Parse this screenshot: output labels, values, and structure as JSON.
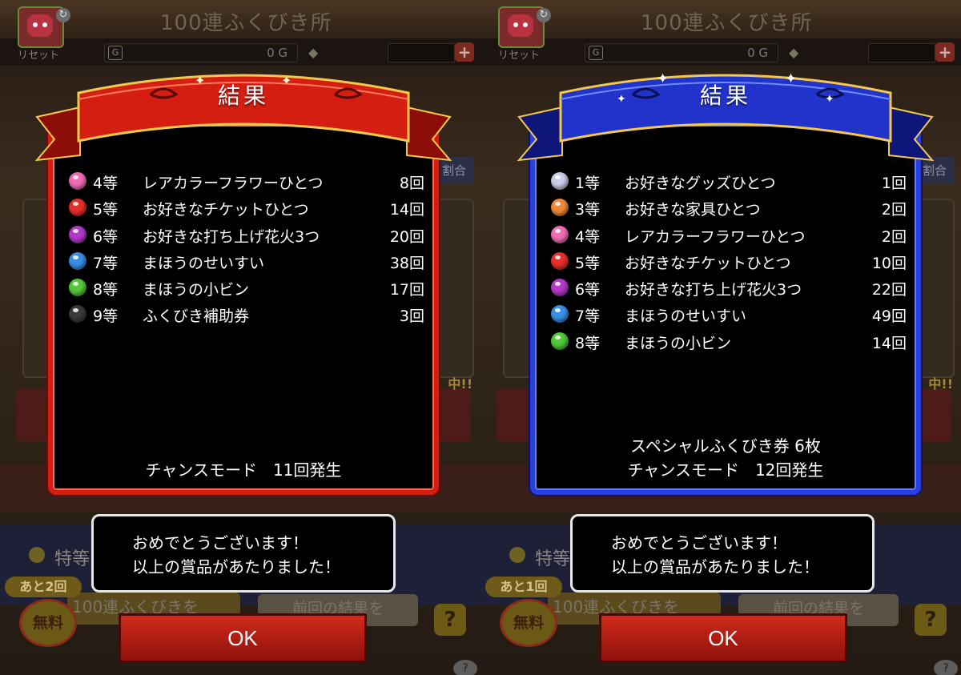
{
  "screens": [
    {
      "header": {
        "title": "100連ふくびき所",
        "reset_label": "リセット",
        "gold": "0 G",
        "gold_icon": "G",
        "plus": "+"
      },
      "background": {
        "side_tag": "割合",
        "side_chu": "中!!",
        "feature_label": "特等",
        "remain_badge": "あと2回",
        "free_badge": "無料",
        "gacha_button": "100連ふくびきを",
        "prev_button": "前回の結果を",
        "help": "?"
      },
      "theme": {
        "ribbon": "#d41e12",
        "ribbon_dark": "#8d0e08",
        "trim": "#f2c94c"
      },
      "dialog": {
        "title": "結果",
        "prizes": [
          {
            "rank": "4等",
            "name": "レアカラーフラワーひとつ",
            "count": "8回",
            "orb_color": "#f06cb4"
          },
          {
            "rank": "5等",
            "name": "お好きなチケットひとつ",
            "count": "14回",
            "orb_color": "#e8302a"
          },
          {
            "rank": "6等",
            "name": "お好きな打ち上げ花火3つ",
            "count": "20回",
            "orb_color": "#b43ac8"
          },
          {
            "rank": "7等",
            "name": "まほうのせいすい",
            "count": "38回",
            "orb_color": "#3a8ee8"
          },
          {
            "rank": "8等",
            "name": "まほうの小ビン",
            "count": "17回",
            "orb_color": "#52c83a"
          },
          {
            "rank": "9等",
            "name": "ふくびき補助券",
            "count": "3回",
            "orb_color": "#3a3a3a"
          }
        ],
        "footer_lines": [
          "チャンスモード　11回発生"
        ]
      },
      "message": {
        "lines": [
          "おめでとうございます！",
          "以上の賞品があたりました！"
        ]
      },
      "ok_label": "OK"
    },
    {
      "header": {
        "title": "100連ふくびき所",
        "reset_label": "リセット",
        "gold": "0 G",
        "gold_icon": "G",
        "plus": "+"
      },
      "background": {
        "side_tag": "割合",
        "side_chu": "中!!",
        "feature_label": "特等",
        "remain_badge": "あと1回",
        "free_badge": "無料",
        "gacha_button": "100連ふくびきを",
        "prev_button": "前回の結果を",
        "help": "?"
      },
      "theme": {
        "ribbon": "#2233cc",
        "ribbon_dark": "#0e167a",
        "trim": "#f2c94c"
      },
      "dialog": {
        "title": "結果",
        "prizes": [
          {
            "rank": "1等",
            "name": "お好きなグッズひとつ",
            "count": "1回",
            "orb_color": "#c9cde8"
          },
          {
            "rank": "3等",
            "name": "お好きな家具ひとつ",
            "count": "2回",
            "orb_color": "#f08a3a"
          },
          {
            "rank": "4等",
            "name": "レアカラーフラワーひとつ",
            "count": "2回",
            "orb_color": "#f06cb4"
          },
          {
            "rank": "5等",
            "name": "お好きなチケットひとつ",
            "count": "10回",
            "orb_color": "#e8302a"
          },
          {
            "rank": "6等",
            "name": "お好きな打ち上げ花火3つ",
            "count": "22回",
            "orb_color": "#b43ac8"
          },
          {
            "rank": "7等",
            "name": "まほうのせいすい",
            "count": "49回",
            "orb_color": "#3a8ee8"
          },
          {
            "rank": "8等",
            "name": "まほうの小ビン",
            "count": "14回",
            "orb_color": "#52c83a"
          }
        ],
        "footer_lines": [
          "スペシャルふくびき券  6枚",
          "チャンスモード　12回発生"
        ]
      },
      "message": {
        "lines": [
          "おめでとうございます！",
          "以上の賞品があたりました！"
        ]
      },
      "ok_label": "OK"
    }
  ]
}
